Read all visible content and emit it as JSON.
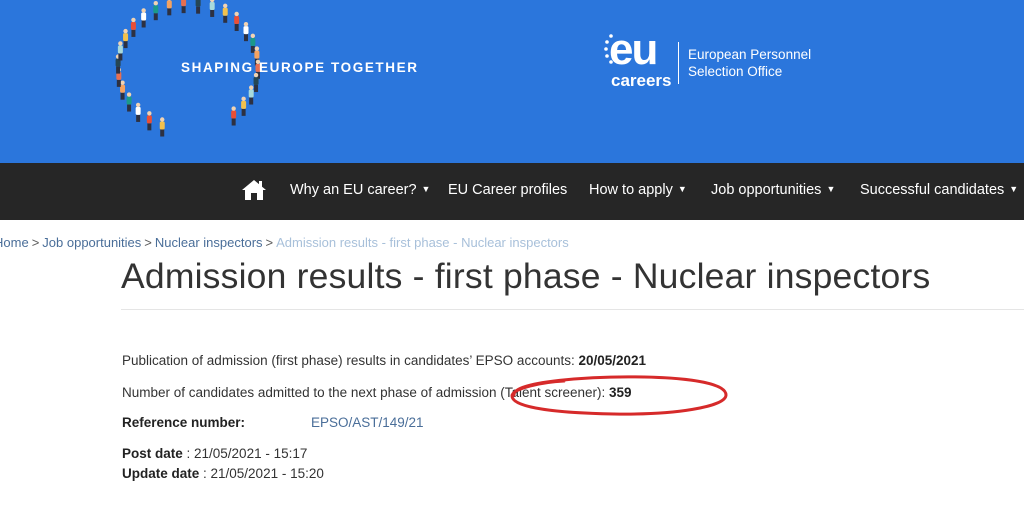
{
  "banner": {
    "tagline": "SHAPING EUROPE TOGETHER",
    "logo_mark": "eu",
    "logo_sub": "careers",
    "office_line1": "European Personnel",
    "office_line2": "Selection Office",
    "background_color": "#2b76dc"
  },
  "nav": {
    "home_icon": "home-icon",
    "items": [
      {
        "label": "Why an EU career?",
        "has_dropdown": true
      },
      {
        "label": "EU Career profiles",
        "has_dropdown": false
      },
      {
        "label": "How to apply",
        "has_dropdown": true
      },
      {
        "label": "Job opportunities",
        "has_dropdown": true
      },
      {
        "label": "Successful candidates",
        "has_dropdown": true
      }
    ],
    "background_color": "#262626"
  },
  "breadcrumb": {
    "items": [
      "Home",
      "Job opportunities",
      "Nuclear inspectors"
    ],
    "current": "Admission results - first phase - Nuclear inspectors",
    "separator": ">"
  },
  "page": {
    "title": "Admission results - first phase - Nuclear inspectors",
    "publication_text": "Publication of admission (first phase) results in candidates’ EPSO accounts: ",
    "publication_date": "20/05/2021",
    "admitted_text": "Number of candidates admitted to the next phase of admission (Talent screener): ",
    "admitted_count": "359",
    "reference_label": "Reference number:",
    "reference_value": "EPSO/AST/149/21",
    "post_date_label": "Post date",
    "post_date_value": " : 21/05/2021 - 15:17",
    "update_date_label": "Update date",
    "update_date_value": " : 21/05/2021 - 15:20"
  },
  "annotation": {
    "color": "#d62a2a"
  }
}
